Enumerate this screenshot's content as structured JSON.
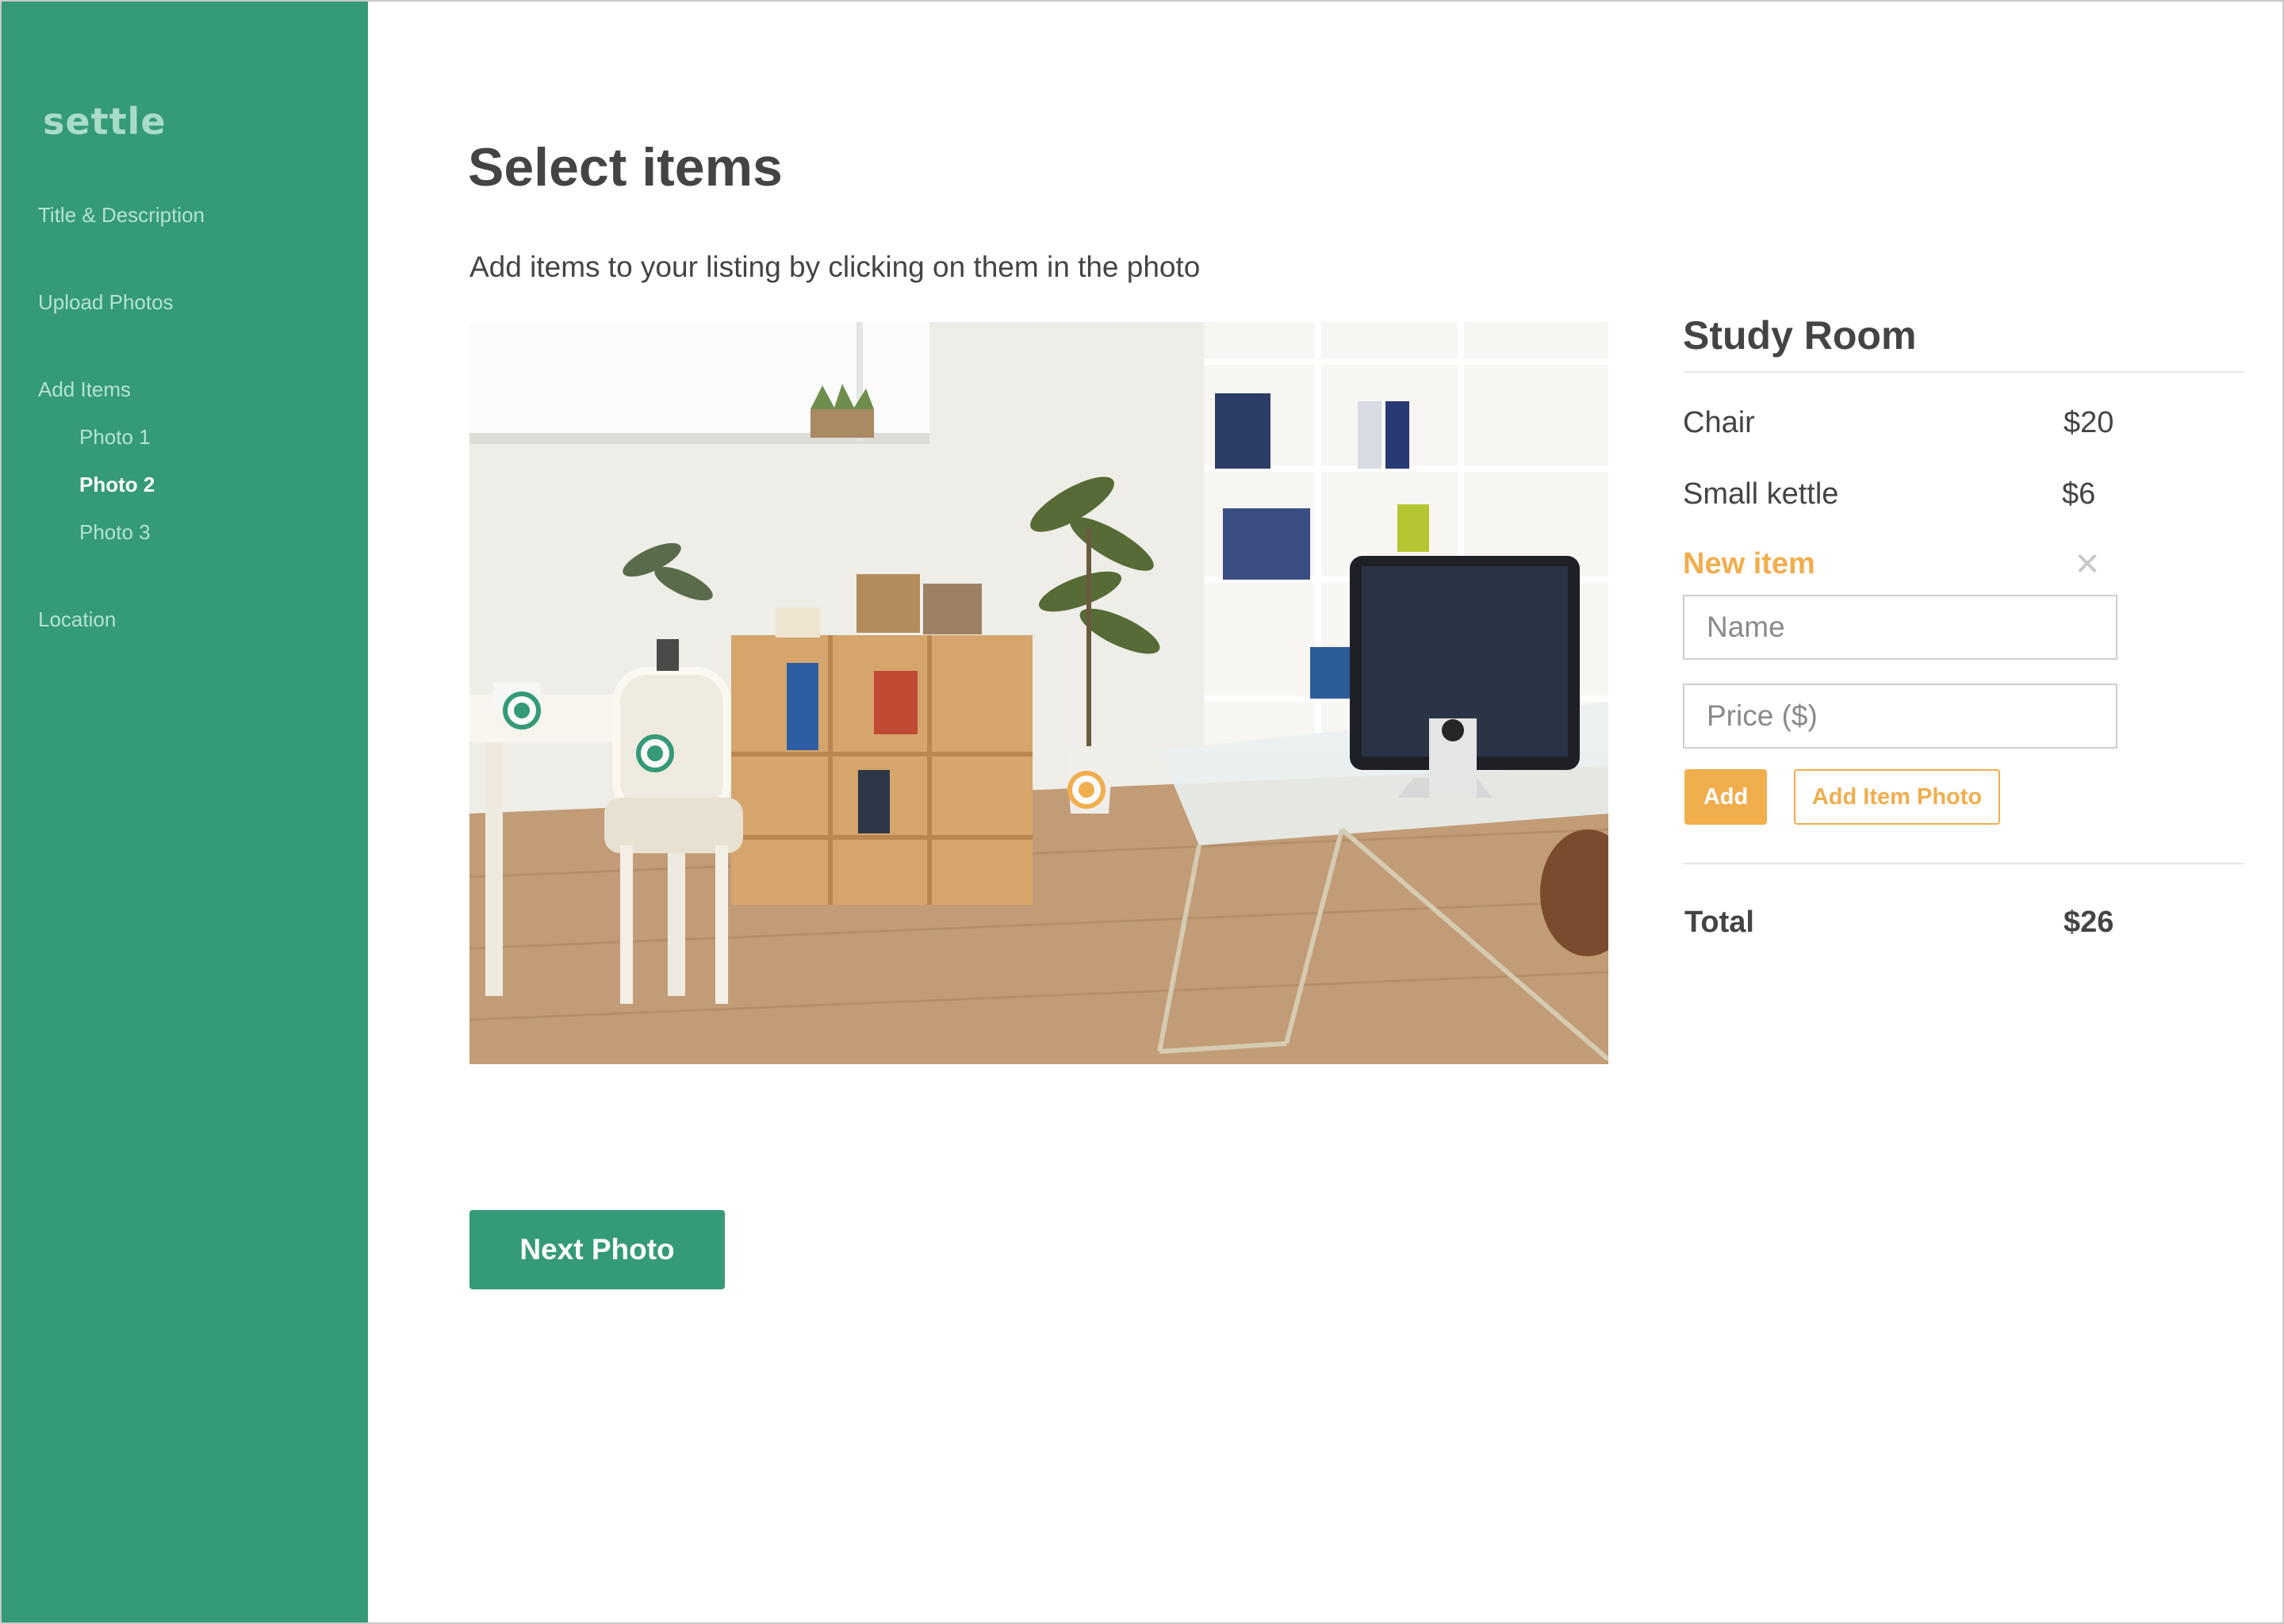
{
  "brand": {
    "logo_text": "settle",
    "color": "#349a77",
    "accent": "#f0ae4d"
  },
  "sidebar": {
    "items": [
      {
        "label": "Title & Description"
      },
      {
        "label": "Upload Photos"
      },
      {
        "label": "Add Items"
      },
      {
        "label": "Location"
      }
    ],
    "photos": [
      {
        "label": "Photo 1",
        "active": false
      },
      {
        "label": "Photo 2",
        "active": true
      },
      {
        "label": "Photo 3",
        "active": false
      }
    ]
  },
  "main": {
    "title": "Select items",
    "subtitle": "Add items to your listing by clicking on them in the photo",
    "next_button": "Next Photo"
  },
  "photo": {
    "markers": [
      {
        "item": "Small kettle",
        "status": "added",
        "color": "green"
      },
      {
        "item": "Chair",
        "status": "added",
        "color": "green"
      },
      {
        "item": "New item",
        "status": "pending",
        "color": "orange"
      }
    ]
  },
  "panel": {
    "room": "Study Room",
    "items": [
      {
        "name": "Chair",
        "price": "$20"
      },
      {
        "name": "Small kettle",
        "price": "$6"
      }
    ],
    "new_item": {
      "heading": "New item",
      "close_icon": "close-icon",
      "name_placeholder": "Name",
      "price_placeholder": "Price ($)",
      "add_button": "Add",
      "photo_button": "Add Item Photo"
    },
    "total_label": "Total",
    "total_value": "$26"
  }
}
